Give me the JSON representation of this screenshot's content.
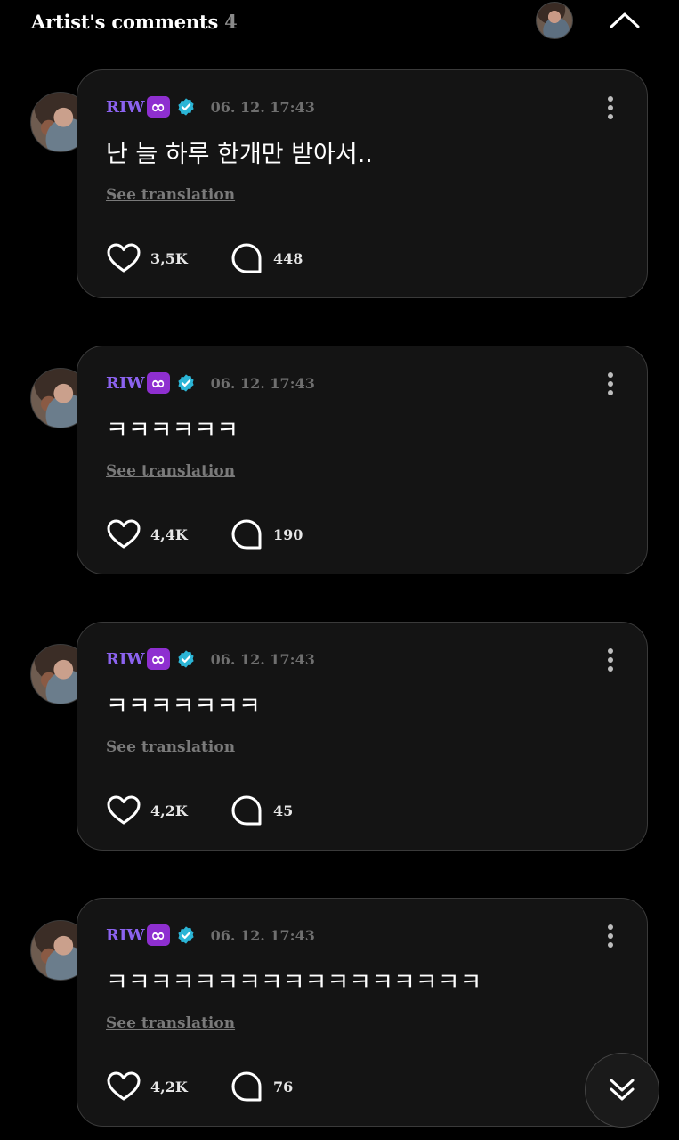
{
  "header": {
    "title": "Artist's comments",
    "count": "4"
  },
  "comments": [
    {
      "author": "RIW",
      "badge": "∞",
      "timestamp": "06. 12. 17:43",
      "text": "난 늘 하루 한개만 받아서..",
      "translate_label": "See translation",
      "likes": "3,5K",
      "replies": "448"
    },
    {
      "author": "RIW",
      "badge": "∞",
      "timestamp": "06. 12. 17:43",
      "text": "ㅋㅋㅋㅋㅋㅋ",
      "translate_label": "See translation",
      "likes": "4,4K",
      "replies": "190"
    },
    {
      "author": "RIW",
      "badge": "∞",
      "timestamp": "06. 12. 17:43",
      "text": "ㅋㅋㅋㅋㅋㅋㅋ",
      "translate_label": "See translation",
      "likes": "4,2K",
      "replies": "45"
    },
    {
      "author": "RIW",
      "badge": "∞",
      "timestamp": "06. 12. 17:43",
      "text": "ㅋㅋㅋㅋㅋㅋㅋㅋㅋㅋㅋㅋㅋㅋㅋㅋㅋ",
      "translate_label": "See translation",
      "likes": "4,2K",
      "replies": "76"
    }
  ],
  "icons": {
    "collapse": "chevron-up-icon",
    "more": "more-vertical-icon",
    "verified": "verified-badge-icon",
    "like": "heart-icon",
    "reply": "comment-bubble-icon",
    "scroll": "double-chevron-down-icon"
  },
  "colors": {
    "background": "#000000",
    "card": "#141414",
    "author": "#8c63f0",
    "badge": "#8e2fd0",
    "verified": "#2bb5d6",
    "muted": "#6f6f6f"
  }
}
